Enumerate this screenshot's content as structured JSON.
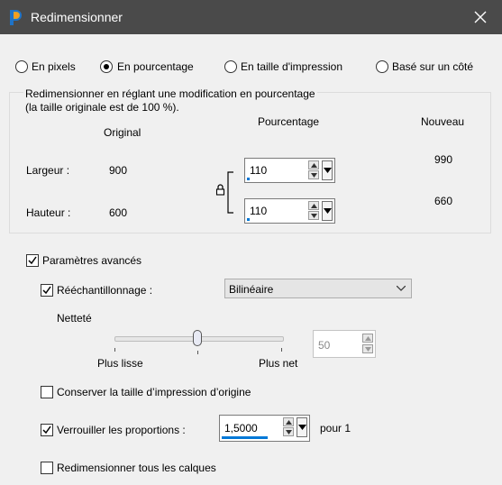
{
  "window": {
    "title": "Redimensionner"
  },
  "modes": [
    {
      "label": "En pixels",
      "selected": false
    },
    {
      "label": "En pourcentage",
      "selected": true
    },
    {
      "label": "En taille d'impression",
      "selected": false
    },
    {
      "label": "Basé sur un côté",
      "selected": false
    }
  ],
  "group": {
    "title": "Redimensionner en réglant une modification en pourcentage\n(la taille originale est de 100 %).",
    "col_original": "Original",
    "col_percent": "Pourcentage",
    "col_new": "Nouveau",
    "width": {
      "label": "Largeur :",
      "original": "900",
      "percent": "110",
      "new": "990"
    },
    "height": {
      "label": "Hauteur :",
      "original": "600",
      "percent": "110",
      "new": "660"
    },
    "link_locked": true
  },
  "advanced": {
    "label": "Paramètres avancés",
    "checked": true,
    "resample": {
      "label": "Rééchantillonnage :",
      "checked": true,
      "method": "Bilinéaire"
    },
    "sharpness": {
      "label": "Netteté",
      "value": "50",
      "level": 0.47,
      "min_label": "Plus lisse",
      "max_label": "Plus net"
    },
    "keep_print_size": {
      "label": "Conserver la taille d’impression d’origine",
      "checked": false
    },
    "lock_ratio": {
      "label": "Verrouiller les proportions :",
      "checked": true,
      "value": "1,5000",
      "suffix": "pour 1"
    },
    "resize_all_layers": {
      "label": "Redimensionner tous les calques",
      "checked": false
    }
  },
  "colors": {
    "titlebar": "#4a4a4a",
    "accent": "#0078d7",
    "background": "#f0f0f0"
  }
}
